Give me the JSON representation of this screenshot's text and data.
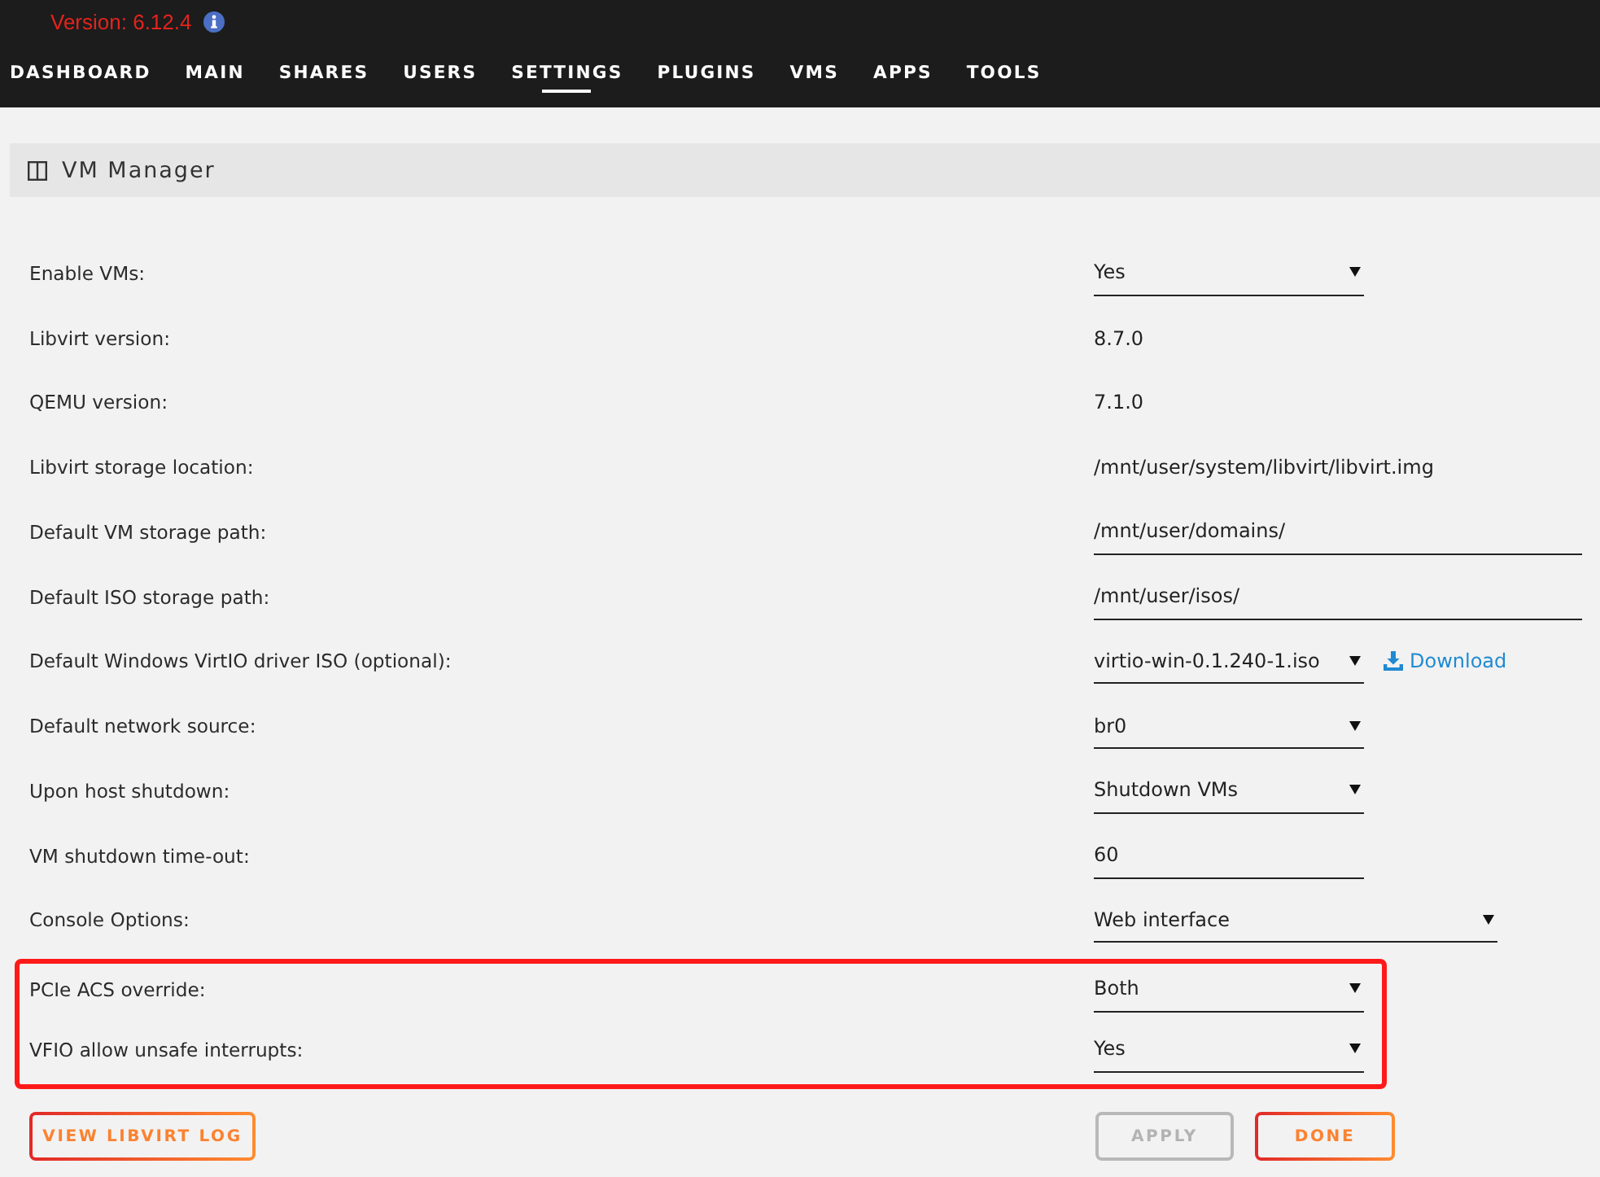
{
  "header": {
    "version": "Version: 6.12.4"
  },
  "nav": [
    {
      "label": "DASHBOARD",
      "selected": false
    },
    {
      "label": "MAIN",
      "selected": false
    },
    {
      "label": "SHARES",
      "selected": false
    },
    {
      "label": "USERS",
      "selected": false
    },
    {
      "label": "SETTINGS",
      "selected": true
    },
    {
      "label": "PLUGINS",
      "selected": false
    },
    {
      "label": "VMS",
      "selected": false
    },
    {
      "label": "APPS",
      "selected": false
    },
    {
      "label": "TOOLS",
      "selected": false
    }
  ],
  "panel": {
    "title": "VM Manager"
  },
  "settings": [
    {
      "label": "Enable VMs:",
      "kind": "select",
      "value": "Yes",
      "highlighted": false
    },
    {
      "label": "Libvirt version:",
      "kind": "info",
      "value": "8.7.0",
      "highlighted": false
    },
    {
      "label": "QEMU version:",
      "kind": "info",
      "value": "7.1.0",
      "highlighted": false
    },
    {
      "label": "Libvirt storage location:",
      "kind": "info",
      "value": "/mnt/user/system/libvirt/libvirt.img",
      "highlighted": false
    },
    {
      "label": "Default VM storage path:",
      "kind": "path",
      "value": "/mnt/user/domains/",
      "highlighted": false
    },
    {
      "label": "Default ISO storage path:",
      "kind": "path",
      "value": "/mnt/user/isos/",
      "highlighted": false
    },
    {
      "label": "Default Windows VirtIO driver ISO (optional):",
      "kind": "select",
      "value": "virtio-win-0.1.240-1.iso",
      "link": "Download",
      "highlighted": false
    },
    {
      "label": "Default network source:",
      "kind": "select",
      "value": "br0",
      "highlighted": false
    },
    {
      "label": "Upon host shutdown:",
      "kind": "select",
      "value": "Shutdown VMs",
      "highlighted": false
    },
    {
      "label": "VM shutdown time-out:",
      "kind": "number",
      "value": "60",
      "highlighted": false
    },
    {
      "label": "Console Options:",
      "kind": "wideselect",
      "value": "Web interface",
      "highlighted": false
    },
    {
      "label": "PCIe ACS override:",
      "kind": "select",
      "value": "Both",
      "highlighted": true
    },
    {
      "label": "VFIO allow unsafe interrupts:",
      "kind": "select",
      "value": "Yes",
      "highlighted": true
    }
  ],
  "buttons": [
    {
      "label": "VIEW LIBVIRT LOG",
      "disabled": false
    },
    {
      "label": "APPLY",
      "disabled": true
    },
    {
      "label": "DONE",
      "disabled": false
    }
  ]
}
